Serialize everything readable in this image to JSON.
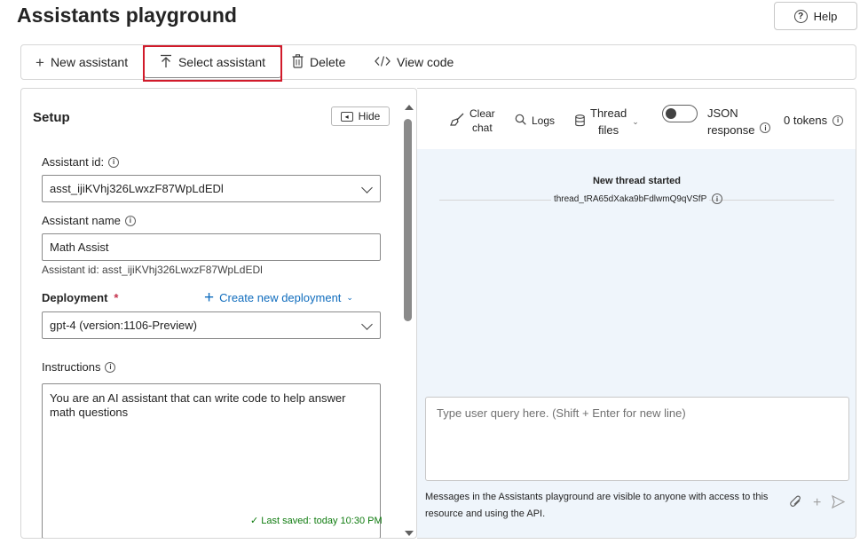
{
  "page": {
    "title": "Assistants playground"
  },
  "help": {
    "label": "Help"
  },
  "toolbar": {
    "new_assistant": "New assistant",
    "select_assistant": "Select assistant",
    "delete": "Delete",
    "view_code": "View code"
  },
  "setup": {
    "title": "Setup",
    "hide_label": "Hide",
    "assistant_id_label": "Assistant id:",
    "assistant_id_value": "asst_ijiKVhj326LwxzF87WpLdEDl",
    "assistant_name_label": "Assistant name",
    "assistant_name_value": "Math Assist",
    "assistant_id_note": "Assistant id: asst_ijiKVhj326LwxzF87WpLdEDl",
    "deployment_label": "Deployment",
    "deployment_required": "*",
    "create_deployment": "Create new deployment",
    "deployment_value": "gpt-4 (version:1106-Preview)",
    "instructions_label": "Instructions",
    "instructions_value": "You are an AI assistant that can write code to help answer math questions",
    "last_saved": "✓ Last saved: today 10:30 PM"
  },
  "chat_toolbar": {
    "clear_line1": "Clear",
    "clear_line2": "chat",
    "logs": "Logs",
    "thread_line1": "Thread",
    "thread_line2": "files",
    "json_line1": "JSON",
    "json_line2": "response",
    "json_response_on": false,
    "tokens": "0 tokens"
  },
  "chat": {
    "new_thread": "New thread started",
    "thread_id": "thread_tRA65dXaka9bFdlwmQ9qVSfP",
    "query_placeholder": "Type user query here. (Shift + Enter for new line)",
    "disclaimer": "Messages in the Assistants playground are visible to anyone with access to this resource and using the API."
  },
  "colors": {
    "accent": "#0f6cbd",
    "highlight_border": "#d11a2a",
    "chat_background": "#eff5fb",
    "saved_green": "#107c10"
  }
}
